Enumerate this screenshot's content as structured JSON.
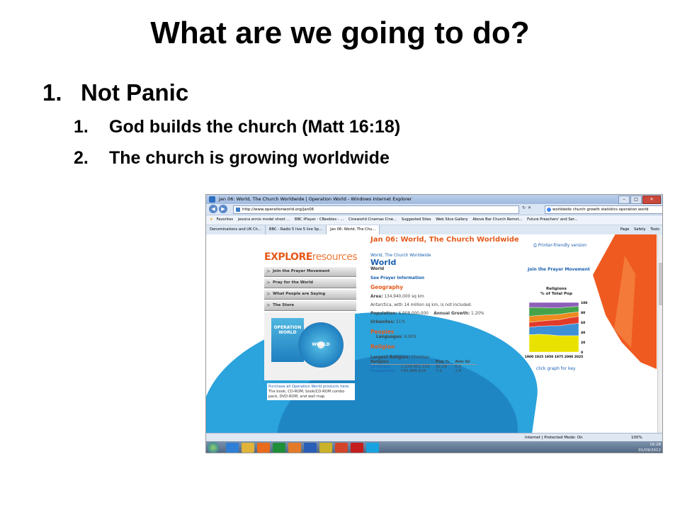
{
  "slide": {
    "title": "What are we going to do?",
    "point1": {
      "num": "1.",
      "text": "Not Panic"
    },
    "sub": [
      {
        "num": "1.",
        "text": "God builds the church (Matt 16:18)"
      },
      {
        "num": "2.",
        "text": "The church is growing worldwide"
      }
    ]
  },
  "browser": {
    "window_title": "Jan 06: World, The Church Worldwide | Operation World - Windows Internet Explorer",
    "address": "http://www.operationworld.org/jan06",
    "search": "worldwide church growth statistics operation world",
    "favorites": [
      "Favorites",
      "jessica ennis model shoot ...",
      "BBC iPlayer - CBeebies - ...",
      "Cineworld Cinemas Cine...",
      "Suggested Sites",
      "Web Slice Gallery",
      "Above Bar Church Remot...",
      "Future Preachers' and Ser..."
    ],
    "tabs": [
      "Denominations and UK Ch...",
      "BBC - Radio 5 live 5 live Sp...",
      "Jan 06: World, The Chu..."
    ],
    "tools": [
      "Page",
      "Safety",
      "Tools"
    ],
    "status_zone": "Internet | Protected Mode: On",
    "zoom": "100%",
    "clock_time": "16:28",
    "clock_date": "01/09/2012"
  },
  "page": {
    "explore_a": "EXPLORE",
    "explore_b": "resources",
    "menu": [
      "Join the Prayer Movement",
      "Pray for the World",
      "What People are Saying",
      "The Store"
    ],
    "book_label": "OPERATION WORLD",
    "cd_label": "WORLD",
    "purchase_link": "Purchase all Operation World products here:",
    "purchase_text": "The book, CD-ROM, book/CD-ROM combo pack, DVD-ROM, and wall map",
    "heading": "Jan 06: World, The Church Worldwide",
    "crumb": "World, The Church Worldwide",
    "country": "World",
    "country_small": "World",
    "see_prayer": "See Prayer Information",
    "geography": "Geography",
    "area_label": "Area:",
    "area_value": "134,940,000 sq km",
    "antarctica": "Antarctica, with 14 million sq km, is not included.",
    "population_label": "Population:",
    "population_value": "6,908,000,000",
    "growth_label": "Annual Growth:",
    "growth_value": "1.20%",
    "urbanites_label": "Urbanites:",
    "urbanites_value": "51%",
    "peoples": "Peoples",
    "languages_label": "Languages:",
    "languages_value": "6,909",
    "religion": "Religion",
    "largest_label": "Largest Religion:",
    "largest_value": "Christian",
    "table_headers": [
      "Religion",
      "Pop %",
      "Ann Gr"
    ],
    "table_rows": [
      {
        "name": "Christians",
        "pop": "2,229,951,315",
        "pct": "32.29",
        "gr": "0.0"
      },
      {
        "name": "Evangelicals",
        "pop": "545,886,818",
        "pct": "7.9",
        "gr": "2.6"
      }
    ],
    "printer": "Printer-friendly version",
    "prayer_link": "Join the Prayer Movement",
    "chart_title_1": "Religions",
    "chart_title_2": "% of Total Pop",
    "click_graph": "click graph for key"
  },
  "chart_data": {
    "type": "area",
    "title": "Religions",
    "subtitle": "% of Total Pop",
    "x": [
      1900,
      1925,
      1950,
      1975,
      2000,
      2025
    ],
    "x_ticks": [
      "1900",
      "1925",
      "1950",
      "1975",
      "2000",
      "2025"
    ],
    "y_ticks": [
      "100",
      "80",
      "60",
      "40",
      "20",
      "0"
    ],
    "ylim": [
      0,
      100
    ],
    "series": [
      {
        "values": [
          35,
          36,
          35,
          33,
          33,
          33
        ],
        "color": "#e9e200"
      },
      {
        "values": [
          15,
          16,
          18,
          20,
          23,
          25
        ],
        "color": "#3d8fd6"
      },
      {
        "values": [
          10,
          10,
          11,
          12,
          13,
          14
        ],
        "color": "#e23a2a"
      },
      {
        "values": [
          12,
          12,
          11,
          11,
          10,
          9
        ],
        "color": "#ee8a1e"
      },
      {
        "values": [
          18,
          16,
          14,
          13,
          12,
          11
        ],
        "color": "#44a34a"
      },
      {
        "values": [
          10,
          10,
          11,
          11,
          9,
          8
        ],
        "color": "#8d5fb8"
      }
    ]
  }
}
